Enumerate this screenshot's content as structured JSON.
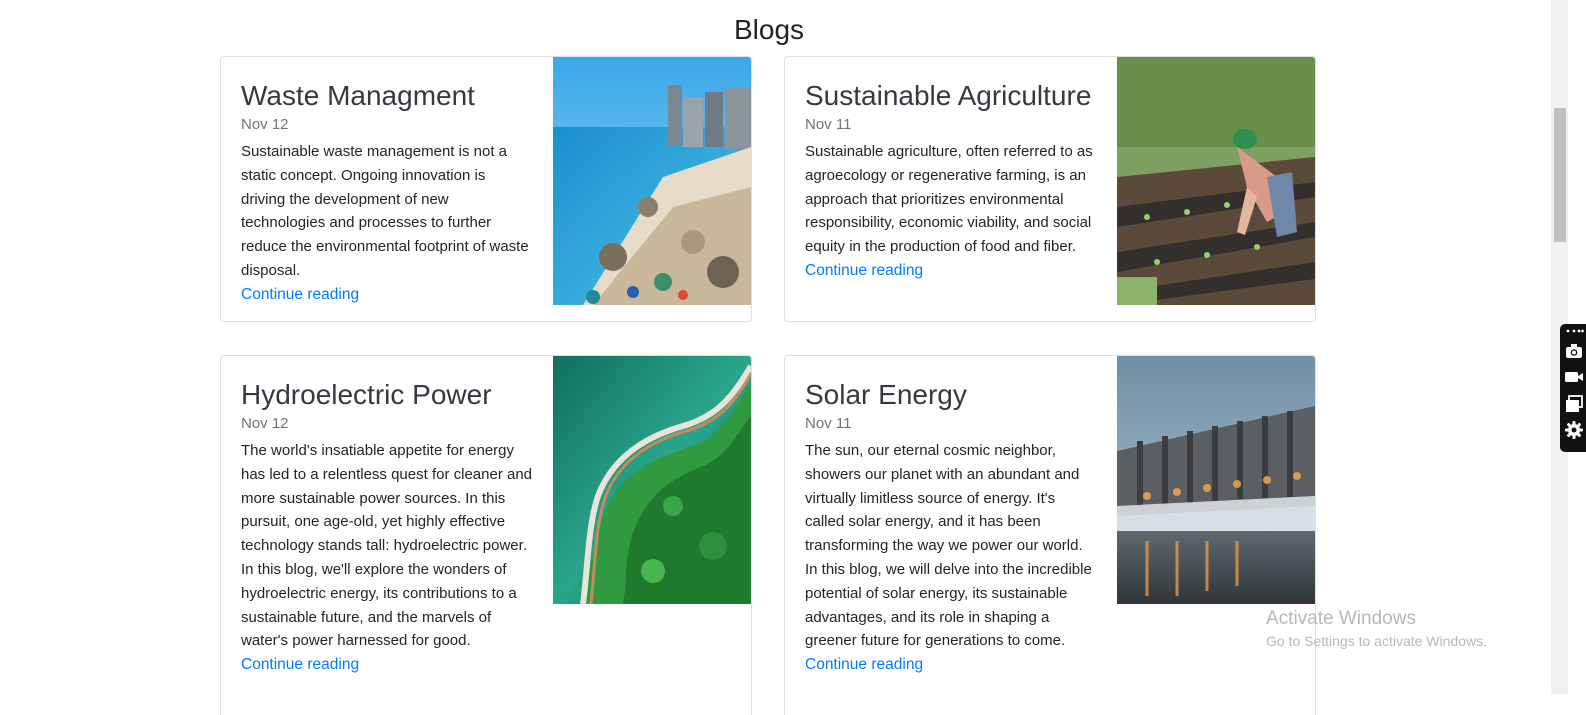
{
  "page": {
    "title": "Blogs"
  },
  "posts": [
    {
      "title": "Waste Managment",
      "date": "Nov 12",
      "excerpt": "Sustainable waste management is not a static concept. Ongoing innovation is driving the development of new technologies and processes to further reduce the environmental footprint of waste disposal.",
      "link": "Continue reading",
      "image": "beach-with-plastic-waste"
    },
    {
      "title": "Sustainable Agriculture",
      "date": "Nov 11",
      "excerpt": "Sustainable agriculture, often referred to as agroecology or regenerative farming, is an approach that prioritizes environmental responsibility, economic viability, and social equity in the production of food and fiber.",
      "link": "Continue reading",
      "image": "farmer-planting-seedlings"
    },
    {
      "title": "Hydroelectric Power",
      "date": "Nov 12",
      "excerpt": "The world's insatiable appetite for energy has led to a relentless quest for cleaner and more sustainable power sources. In this pursuit, one age-old, yet highly effective technology stands tall: hydroelectric power. In this blog, we'll explore the wonders of hydroelectric energy, its contributions to a sustainable future, and the marvels of water's power harnessed for good.",
      "link": "Continue reading",
      "image": "aerial-dam-green-water"
    },
    {
      "title": "Solar Energy",
      "date": "Nov 11",
      "excerpt": "The sun, our eternal cosmic neighbor, showers our planet with an abundant and virtually limitless source of energy. It's called solar energy, and it has been transforming the way we power our world. In this blog, we will delve into the incredible potential of solar energy, its sustainable advantages, and its role in shaping a greener future for generations to come.",
      "link": "Continue reading",
      "image": "dam-spillway-at-dusk"
    }
  ],
  "toolbar": {
    "icons": [
      "more-icon",
      "camera-icon",
      "video-camera-icon",
      "window-icon",
      "gear-icon"
    ]
  },
  "watermark": {
    "line1": "Activate Windows",
    "line2": "Go to Settings to activate Windows."
  },
  "colors": {
    "link": "#007bff",
    "card_border": "#dcdfe3",
    "title": "#343a40",
    "muted": "#6c757d"
  }
}
